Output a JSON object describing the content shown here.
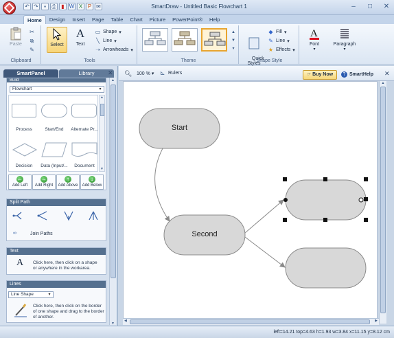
{
  "window": {
    "title": "SmartDraw - Untitled Basic Flowchart 1",
    "controls": {
      "minimize": "–",
      "maximize": "□",
      "close": "✕"
    }
  },
  "quick_access": [
    "undo-icon",
    "redo-icon",
    "save-icon",
    "print-icon",
    "pdf-icon",
    "word-icon",
    "excel-icon",
    "ppt-icon",
    "email-icon"
  ],
  "menu_tabs": [
    "Home",
    "Design",
    "Insert",
    "Page",
    "Table",
    "Chart",
    "Picture",
    "PowerPoint®",
    "Help"
  ],
  "ribbon": {
    "clipboard": {
      "paste": "Paste",
      "group": "Clipboard"
    },
    "tools": {
      "select": "Select",
      "text": "Text",
      "shape": "Shape",
      "line": "Line",
      "arrowheads": "Arrowheads",
      "group": "Tools"
    },
    "theme": {
      "group": "Theme"
    },
    "shape_style": {
      "quick_styles": "Quick\nStyles",
      "fill": "Fill",
      "line": "Line",
      "effects": "Effects",
      "group": "Shape Style"
    },
    "font": {
      "label": "Font"
    },
    "paragraph": {
      "label": "Paragraph"
    }
  },
  "panel": {
    "tabs": [
      "SmartPanel",
      "Library"
    ],
    "build": {
      "header": "Build",
      "dropdown": "Flowchart",
      "shapes": [
        "Process",
        "Start/End",
        "Alternate Pr...",
        "Decision",
        "Data (Input/...",
        "Document"
      ],
      "add_buttons": [
        "Add Left",
        "Add Right",
        "Add Above",
        "Add Below"
      ]
    },
    "split_path": {
      "header": "Split Path",
      "join": "Join Paths"
    },
    "text": {
      "header": "Text",
      "help": "Click here, then click on a shape or anywhere in the workarea."
    },
    "lines": {
      "header": "Lines",
      "dropdown": "Line Shape",
      "help": "Click here, then click on the border of one shape and drag to the border of another."
    }
  },
  "workspace_toolbar": {
    "zoom": "100 %",
    "rulers": "Rulers",
    "buy_now": "Buy Now",
    "smarthelp": "SmartHelp"
  },
  "canvas": {
    "shapes": [
      {
        "label": "Start"
      },
      {
        "label": "Second"
      },
      {
        "label": ""
      },
      {
        "label": ""
      }
    ]
  },
  "status": "left=14.21  top=4.63  h=1.93  w=3.84    x=11.15  y=8.12 cm"
}
